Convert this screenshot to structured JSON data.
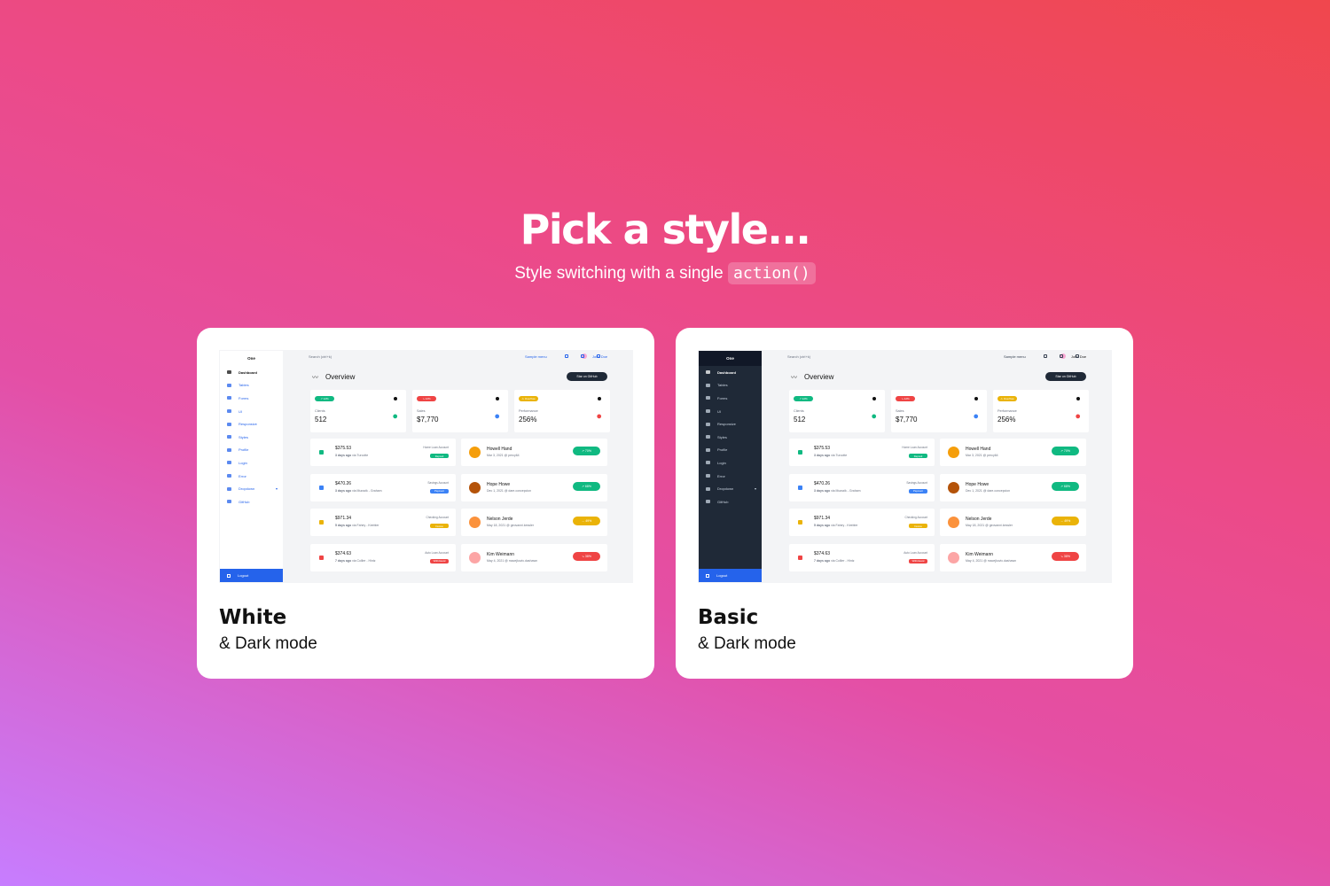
{
  "header": {
    "title": "Pick a style...",
    "subtitle_prefix": "Style switching with a single",
    "subtitle_code": "action()"
  },
  "cards": [
    {
      "title": "White",
      "subtitle": "& Dark mode",
      "variant": "white",
      "sidebar_bg": "#ffffff"
    },
    {
      "title": "Basic",
      "subtitle": "& Dark mode",
      "variant": "basic",
      "sidebar_bg": "#1f2937"
    }
  ],
  "dashboard": {
    "brand": "One",
    "search_placeholder": "Search (ctrl+k)",
    "sample_menu": "Sample menu",
    "user_name": "John Doe",
    "menu": [
      {
        "label": "Dashboard",
        "icon": "monitor-icon"
      },
      {
        "label": "Tables",
        "icon": "table-icon"
      },
      {
        "label": "Forms",
        "icon": "square-edit-icon"
      },
      {
        "label": "UI",
        "icon": "television-guide-icon"
      },
      {
        "label": "Responsive",
        "icon": "responsive-icon"
      },
      {
        "label": "Styles",
        "icon": "palette-icon"
      },
      {
        "label": "Profile",
        "icon": "account-circle-icon"
      },
      {
        "label": "Login",
        "icon": "lock-icon"
      },
      {
        "label": "Error",
        "icon": "alert-circle-icon"
      },
      {
        "label": "Dropdown",
        "icon": "view-list-icon"
      },
      {
        "label": "GitHub",
        "icon": "github-icon"
      }
    ],
    "logout": "Logout",
    "overview": "Overview",
    "github_button": "Star on GitHub",
    "stats": [
      {
        "badge": "↗ 12%",
        "badge_color": "#10b981",
        "label": "Clients",
        "value": "512",
        "icon": "account-multiple-icon",
        "icon_color": "#10b981"
      },
      {
        "badge": "↘ 12%",
        "badge_color": "#ef4444",
        "label": "Sales",
        "value": "$7,770",
        "icon": "cart-outline-icon",
        "icon_color": "#3b82f6"
      },
      {
        "badge": "⚠ Overflow",
        "badge_color": "#eab308",
        "label": "Performance",
        "value": "256%",
        "icon": "chart-timeline-variant-icon",
        "icon_color": "#ef4444"
      }
    ],
    "transactions": [
      {
        "amount": "$375.53",
        "when": "3 days ago",
        "via": "via Turcotte",
        "account": "Home Loan Account",
        "type": "Deposit",
        "color": "#10b981"
      },
      {
        "amount": "$470.26",
        "when": "3 days ago",
        "via": "via Murazik - Graham",
        "account": "Savings Account",
        "type": "Payment",
        "color": "#3b82f6"
      },
      {
        "amount": "$971.34",
        "when": "5 days ago",
        "via": "via Fahey - Keebler",
        "account": "Checking Account",
        "type": "Invoice",
        "color": "#eab308"
      },
      {
        "amount": "$374.63",
        "when": "7 days ago",
        "via": "via Collier - Hintz",
        "account": "Auto Loan Account",
        "type": "Withdrawal",
        "color": "#ef4444"
      }
    ],
    "clients": [
      {
        "name": "Howell Hand",
        "date": "Mar 3, 2021 @ percy64",
        "trend": "↗ 70%",
        "color": "#10b981",
        "avatar": "#f59e0b"
      },
      {
        "name": "Hope Howe",
        "date": "Dec 1, 2021 @ dare.concepcion",
        "trend": "↗ 68%",
        "color": "#10b981",
        "avatar": "#b45309"
      },
      {
        "name": "Nelson Jerde",
        "date": "May 18, 2021 @ geovanni.kessler",
        "trend": "→ 49%",
        "color": "#eab308",
        "avatar": "#fb923c"
      },
      {
        "name": "Kim Weimann",
        "date": "May 4, 2021 @ macejkovic.dashawn",
        "trend": "↘ 38%",
        "color": "#ef4444",
        "avatar": "#fca5a5"
      }
    ]
  }
}
